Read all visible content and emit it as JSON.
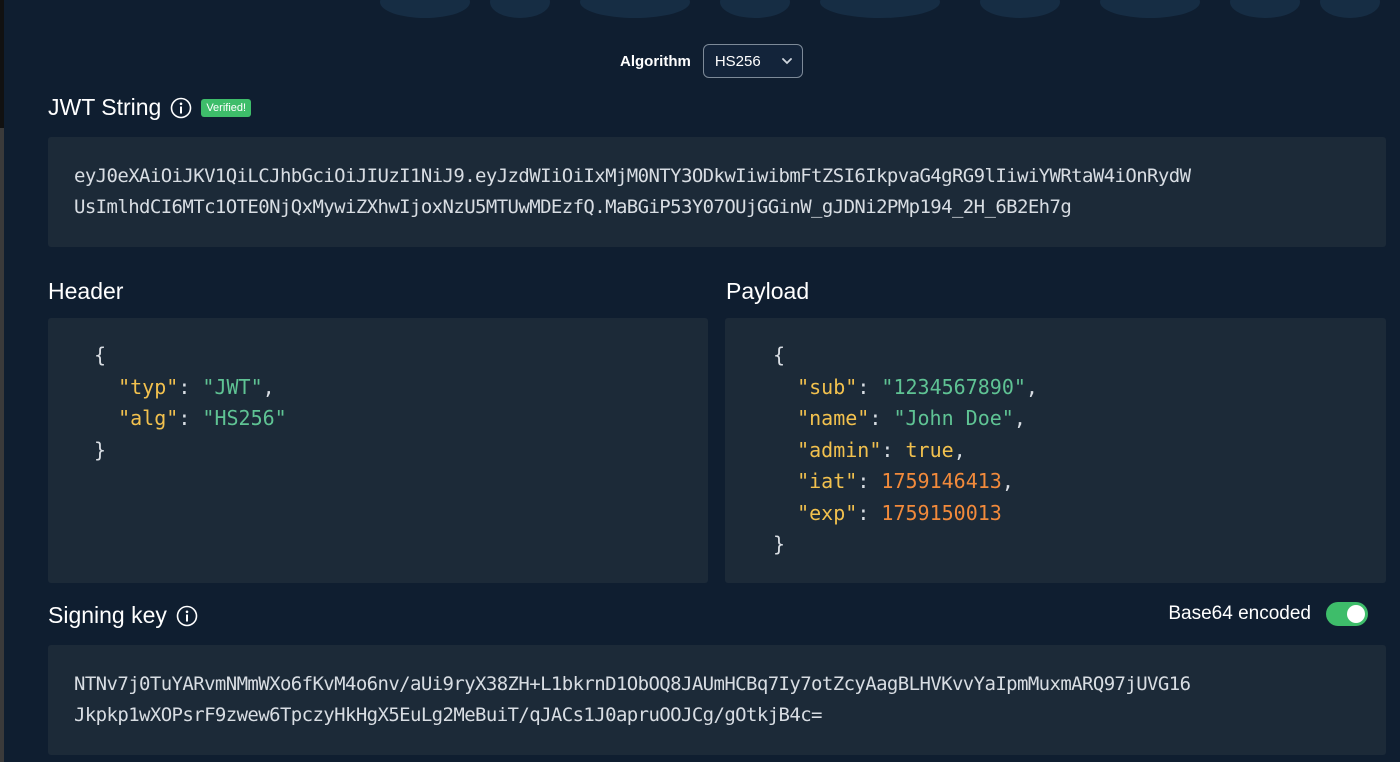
{
  "algorithm": {
    "label": "Algorithm",
    "selected": "HS256"
  },
  "jwt": {
    "title": "JWT String",
    "status_badge": "Verified!",
    "lines": [
      "eyJ0eXAiOiJKV1QiLCJhbGciOiJIUzI1NiJ9.eyJzdWIiOiIxMjM0NTY3ODkwIiwibmFtZSI6IkpvaG4gRG9lIiwiYWRtaW4iOnRydW",
      "UsImlhdCI6MTc1OTE0NjQxMywiZXhwIjoxNzU5MTUwMDEzfQ.MaBGiP53Y07OUjGGinW_gJDNi2PMp194_2H_6B2Eh7g"
    ]
  },
  "header": {
    "title": "Header",
    "fields": [
      {
        "key": "\"typ\"",
        "value": "\"JWT\"",
        "sep": ","
      },
      {
        "key": "\"alg\"",
        "value": "\"HS256\"",
        "sep": ""
      }
    ]
  },
  "payload": {
    "title": "Payload",
    "fields": [
      {
        "key": "\"sub\"",
        "value": "\"1234567890\"",
        "sep": ","
      },
      {
        "key": "\"name\"",
        "value": "\"John Doe\"",
        "sep": ","
      },
      {
        "key": "\"admin\"",
        "value": "true",
        "sep": ","
      },
      {
        "key": "\"iat\"",
        "value": "1759146413",
        "sep": ","
      },
      {
        "key": "\"exp\"",
        "value": "1759150013",
        "sep": ""
      }
    ]
  },
  "signing_key": {
    "title": "Signing key",
    "base64_label": "Base64 encoded",
    "base64_enabled": true,
    "lines": [
      "NTNv7j0TuYARvmNMmWXo6fKvM4o6nv/aUi9ryX38ZH+L1bkrnD1ObOQ8JAUmHCBq7Iy7otZcyAagBLHVKvvYaIpmMuxmARQ97jUVG16",
      "Jkpkp1wXOPsrF9zwew6TpczyHkHgX5EuLg2MeBuiT/qJACs1J0apruOOJCg/gOtkjB4c="
    ]
  },
  "colors": {
    "background": "#0f1e30",
    "panel": "#1c2a38",
    "json_key": "#f2c14e",
    "json_string": "#5fc394",
    "json_number": "#f28a3b",
    "accent_green": "#3ebd6a"
  }
}
